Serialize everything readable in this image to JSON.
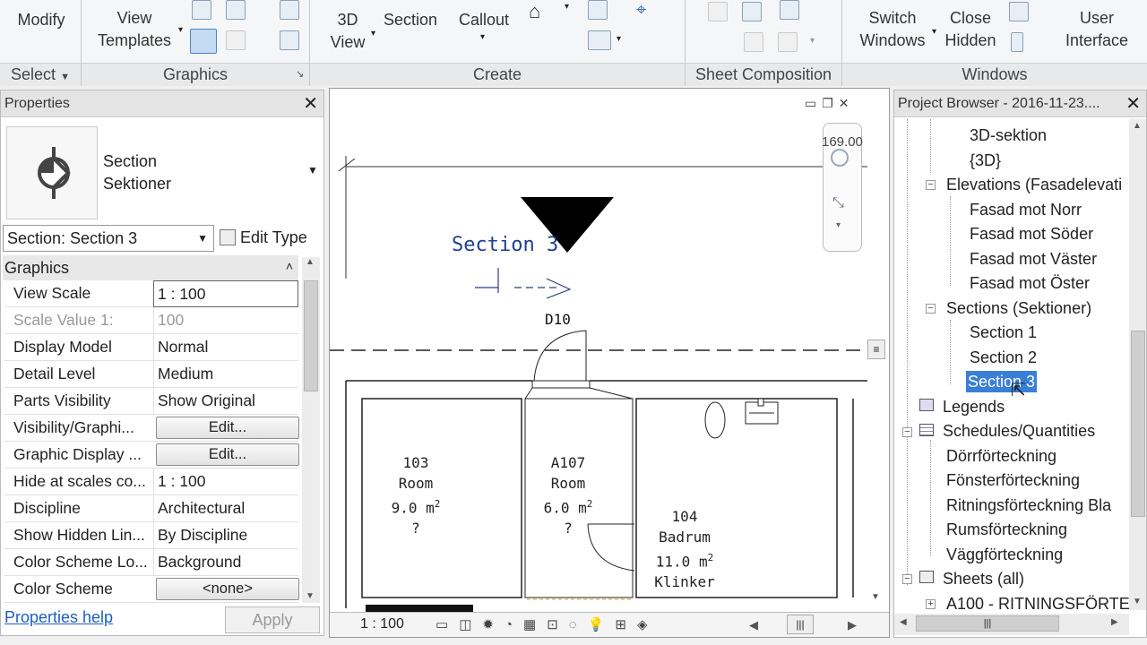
{
  "ribbon": {
    "modify": "Modify",
    "view_templates": [
      "View",
      "Templates"
    ],
    "view_3d": [
      "3D",
      "View"
    ],
    "section": "Section",
    "callout": "Callout",
    "switch_windows": [
      "Switch",
      "Windows"
    ],
    "close_hidden": [
      "Close",
      "Hidden"
    ],
    "user_interface": [
      "User",
      "Interface"
    ],
    "panels": {
      "select": "Select",
      "graphics": "Graphics",
      "create": "Create",
      "sheet_composition": "Sheet Composition",
      "windows": "Windows"
    }
  },
  "properties": {
    "title": "Properties",
    "type_name": "Section",
    "type_family": "Sektioner",
    "selector": "Section: Section 3",
    "edit_type": "Edit Type",
    "group": "Graphics",
    "rows": [
      {
        "label": "View Scale",
        "value": "1 : 100"
      },
      {
        "label": "Scale Value    1:",
        "value": "100"
      },
      {
        "label": "Display Model",
        "value": "Normal"
      },
      {
        "label": "Detail Level",
        "value": "Medium"
      },
      {
        "label": "Parts Visibility",
        "value": "Show Original"
      },
      {
        "label": "Visibility/Graphi...",
        "value": "Edit..."
      },
      {
        "label": "Graphic Display ...",
        "value": "Edit..."
      },
      {
        "label": "Hide at scales co...",
        "value": "1 : 100"
      },
      {
        "label": "Discipline",
        "value": "Architectural"
      },
      {
        "label": "Show Hidden Lin...",
        "value": "By Discipline"
      },
      {
        "label": "Color Scheme Lo...",
        "value": "Background"
      },
      {
        "label": "Color Scheme",
        "value": "<none>"
      }
    ],
    "help_link": "Properties help",
    "apply": "Apply"
  },
  "canvas": {
    "section_tag": "Section 3",
    "door_tag": "D10",
    "viewcube_value": "169.00",
    "rooms": [
      {
        "number": "103",
        "name": "Room",
        "area": "9.0 m",
        "sup": "2",
        "extra": "?"
      },
      {
        "number": "A107",
        "name": "Room",
        "area": "6.0 m",
        "sup": "2",
        "extra": "?"
      },
      {
        "number": "104",
        "name": "Badrum",
        "area": "11.0 m",
        "sup": "2",
        "extra": "Klinker"
      }
    ],
    "status_scale": "1 : 100"
  },
  "browser": {
    "title": "Project Browser - 2016-11-23....",
    "items": [
      "3D-sektion",
      "{3D}",
      "Elevations (Fasadelevati",
      "Fasad mot Norr",
      "Fasad mot Söder",
      "Fasad mot Väster",
      "Fasad mot Öster",
      "Sections (Sektioner)",
      "Section 1",
      "Section 2",
      "Section 3",
      "Legends",
      "Schedules/Quantities",
      "Dörrförteckning",
      "Fönsterförteckning",
      "Ritningsförteckning Bla",
      "Rumsförteckning",
      "Väggförteckning",
      "Sheets (all)",
      "A100 - RITNINGSFÖRTE"
    ]
  }
}
